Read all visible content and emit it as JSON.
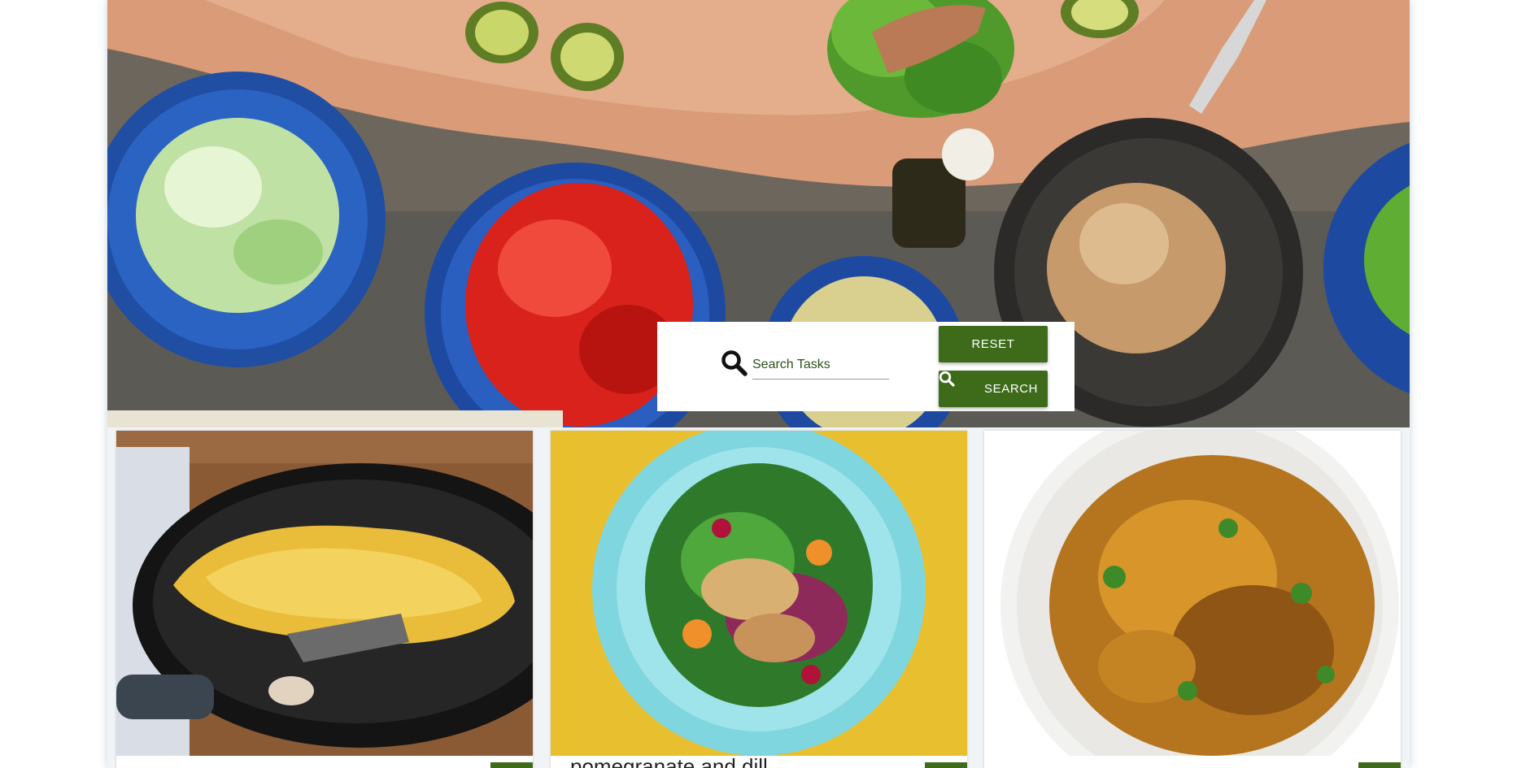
{
  "hero": {
    "image": "salad-ingredients-on-wooden-table"
  },
  "search": {
    "icon": "magnifier-icon",
    "placeholder": "Search Tasks",
    "value": "",
    "reset_label": "RESET",
    "search_label": "SEARCH",
    "search_button_icon": "magnifier-icon"
  },
  "cards": [
    {
      "image": "omelette-in-frying-pan",
      "title": ""
    },
    {
      "image": "halloumi-salad-with-pomegranate",
      "title": "pomegranate and dill"
    },
    {
      "image": "roasted-spiced-potatoes",
      "title": ""
    }
  ],
  "colors": {
    "accent": "#3e6b1a",
    "placeholder_text": "#2f4f1a",
    "page_background": "#ffffff",
    "cards_background": "#f1f4f7"
  }
}
